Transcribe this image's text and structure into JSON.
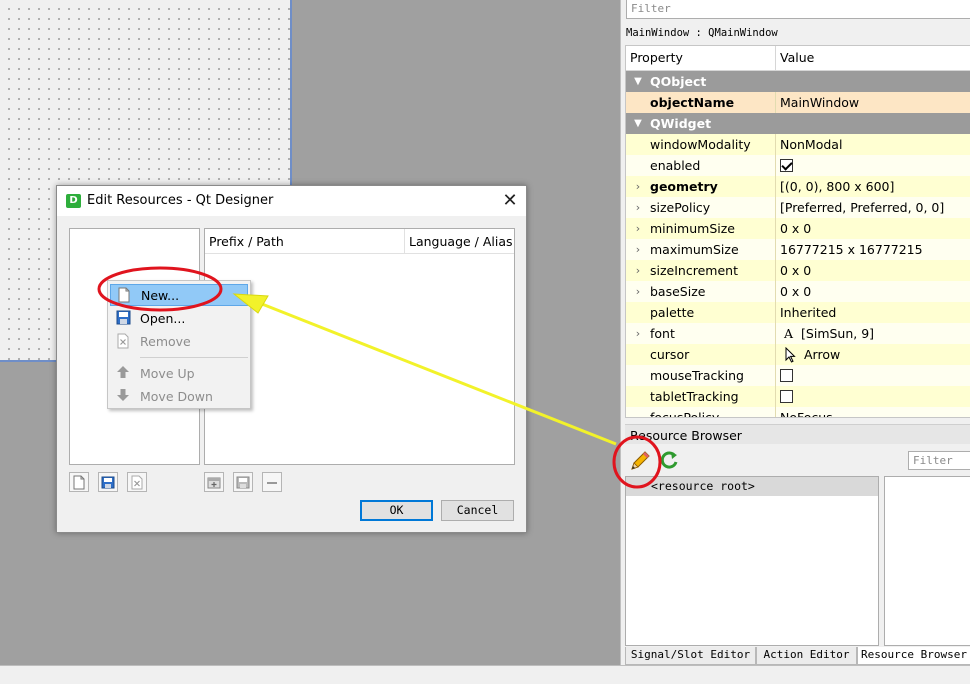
{
  "property_editor": {
    "filter_placeholder": "Filter",
    "object_label": "MainWindow : QMainWindow",
    "headers": {
      "property": "Property",
      "value": "Value"
    },
    "groups": {
      "qobject": "QObject",
      "qwidget": "QWidget"
    },
    "rows": [
      {
        "name": "objectName",
        "value": "MainWindow"
      },
      {
        "name": "windowModality",
        "value": "NonModal"
      },
      {
        "name": "enabled",
        "checked": true
      },
      {
        "name": "geometry",
        "value": "[(0, 0), 800 x 600]"
      },
      {
        "name": "sizePolicy",
        "value": "[Preferred, Preferred, 0, 0]"
      },
      {
        "name": "minimumSize",
        "value": "0 x 0"
      },
      {
        "name": "maximumSize",
        "value": "16777215 x 16777215"
      },
      {
        "name": "sizeIncrement",
        "value": "0 x 0"
      },
      {
        "name": "baseSize",
        "value": "0 x 0"
      },
      {
        "name": "palette",
        "value": "Inherited"
      },
      {
        "name": "font",
        "value": "[SimSun, 9]",
        "glyph": "A"
      },
      {
        "name": "cursor",
        "value": "Arrow"
      },
      {
        "name": "mouseTracking",
        "checked": false
      },
      {
        "name": "tabletTracking",
        "checked": false
      },
      {
        "name": "focusPolicy",
        "value": "NoFocus"
      }
    ]
  },
  "resource_browser": {
    "title": "Resource Browser",
    "filter_placeholder": "Filter",
    "root_item": "<resource root>"
  },
  "bottom_tabs": [
    "Signal/Slot Editor",
    "Action Editor",
    "Resource Browser"
  ],
  "dialog": {
    "title": "Edit Resources - Qt Designer",
    "app_icon": "D",
    "close_glyph": "✕",
    "columns": {
      "prefix_path": "Prefix / Path",
      "language_alias": "Language / Alias"
    },
    "ok_label": "OK",
    "cancel_label": "Cancel"
  },
  "context_menu": {
    "items": [
      "New...",
      "Open...",
      "Remove",
      "Move Up",
      "Move Down"
    ]
  },
  "colors": {
    "annotation_red": "#e0141e",
    "arrow_yellow": "#f2f22a",
    "highlight_blue": "#91c9f7"
  }
}
